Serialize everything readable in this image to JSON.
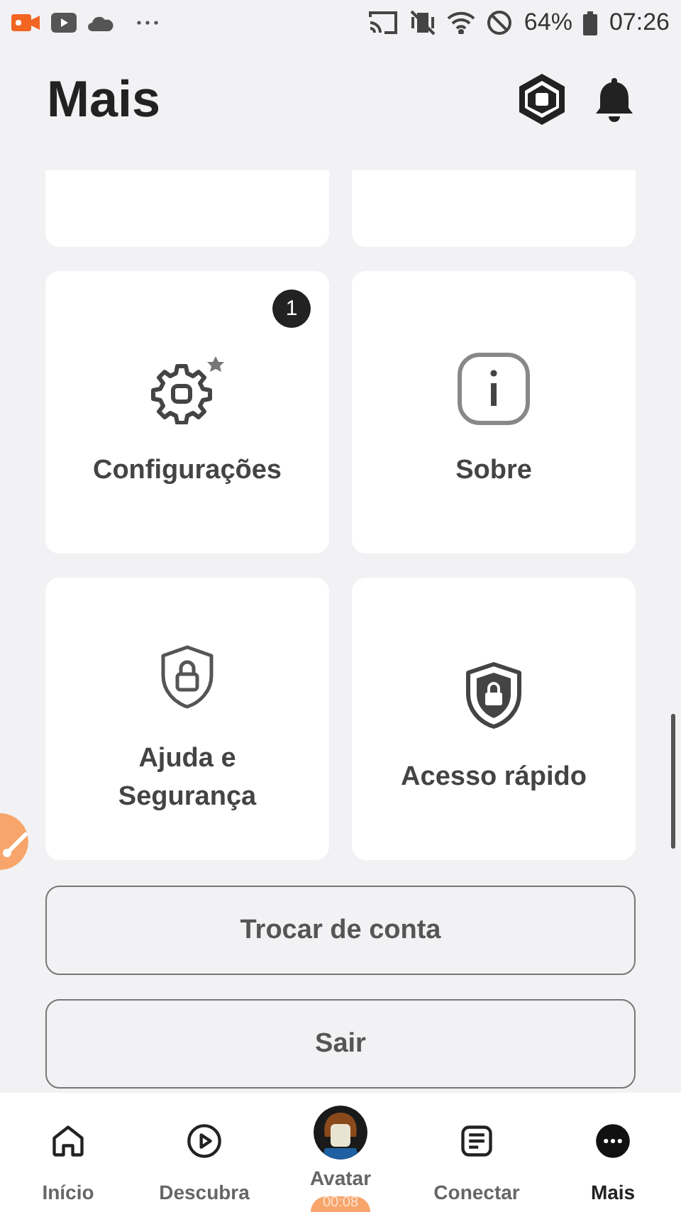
{
  "status_bar": {
    "battery": "64%",
    "time": "07:26"
  },
  "header": {
    "title": "Mais"
  },
  "tiles": [
    {
      "kind": "partial"
    },
    {
      "kind": "partial"
    },
    {
      "kind": "settings",
      "label": "Configurações",
      "badge": "1"
    },
    {
      "kind": "info",
      "label": "Sobre"
    },
    {
      "kind": "help",
      "label": "Ajuda e Segurança"
    },
    {
      "kind": "quick",
      "label": "Acesso rápido"
    }
  ],
  "buttons": [
    {
      "label": "Trocar de conta"
    },
    {
      "label": "Sair"
    }
  ],
  "nav": [
    {
      "kind": "home",
      "label": "Início",
      "selected": false
    },
    {
      "kind": "discover",
      "label": "Descubra",
      "selected": false
    },
    {
      "kind": "avatar",
      "label": "Avatar",
      "selected": false
    },
    {
      "kind": "connect",
      "label": "Conectar",
      "selected": false
    },
    {
      "kind": "more",
      "label": "Mais",
      "selected": true
    }
  ],
  "recorder": {
    "timer": "00:08"
  }
}
